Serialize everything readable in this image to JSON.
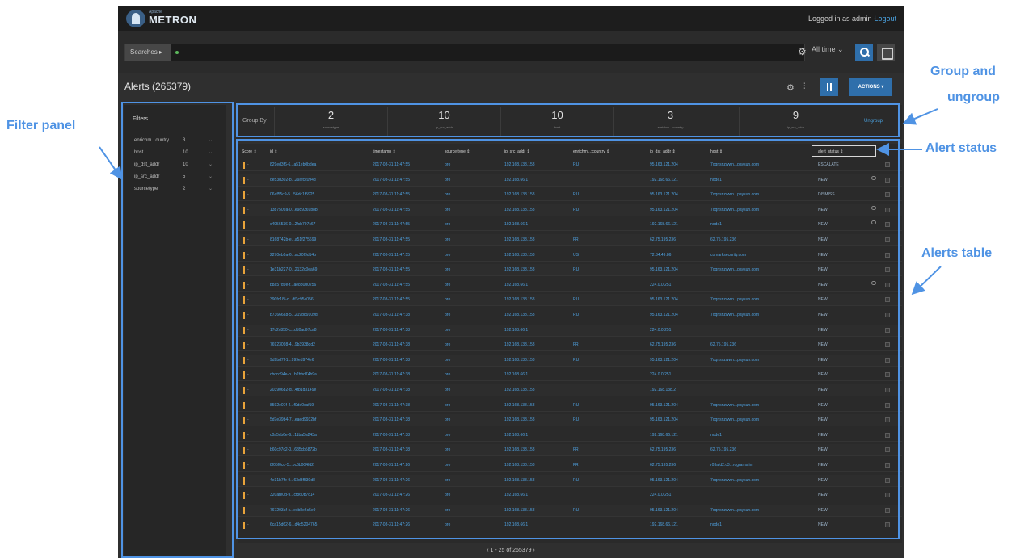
{
  "app": {
    "brand_small": "Apache",
    "brand": "METRON",
    "login_text": "Logged in as admin -",
    "logout_label": "Logout"
  },
  "search": {
    "searches_label": "Searches ▸",
    "time_range": "All time ⌄"
  },
  "alerts": {
    "title": "Alerts (265379)",
    "actions_label": "ACTIONS ▾"
  },
  "filters": {
    "title": "Filters",
    "items": [
      {
        "label": "enrichm...ountry",
        "count": "3"
      },
      {
        "label": "host",
        "count": "10"
      },
      {
        "label": "ip_dst_addr",
        "count": "10"
      },
      {
        "label": "ip_src_addr",
        "count": "5"
      },
      {
        "label": "sourcetype",
        "count": "2"
      }
    ]
  },
  "group_by": {
    "label": "Group By",
    "ungroup_label": "Ungroup",
    "groups": [
      {
        "count": "2",
        "label": "sourcetype"
      },
      {
        "count": "10",
        "label": "ip_src_addr"
      },
      {
        "count": "10",
        "label": "host"
      },
      {
        "count": "3",
        "label": "enrichm...:country"
      },
      {
        "count": "9",
        "label": "ip_src_addr"
      }
    ]
  },
  "table": {
    "columns": [
      "Score ⇕",
      "id ⇕",
      "timestamp ⇕",
      "source:type ⇕",
      "ip_src_addr ⇕",
      "enrichm...:country ⇕",
      "ip_dst_addr ⇕",
      "host ⇕",
      "alert_status ⇕"
    ],
    "rows": [
      [
        "829ed3f6-6...a51eb0bdea",
        "2017-08-31 11:47:55",
        "bro",
        "192.168.138.158",
        "RU",
        "95.163.121.204",
        "7oqnsnzwwn...paysun.com",
        "ESCALATE",
        false
      ],
      [
        "de53d302-b...29afcc094d",
        "2017-08-31 11:47:55",
        "bro",
        "192.168.66.1",
        "",
        "192.168.66.121",
        "node1",
        "NEW",
        true
      ],
      [
        "06af55c9-5...56dc1f5925",
        "2017-08-31 11:47:55",
        "bro",
        "192.168.138.158",
        "RU",
        "95.163.121.204",
        "7oqnsnzwwn...paysun.com",
        "DISMISS",
        false
      ],
      [
        "13b7509a-0...e989369b8b",
        "2017-08-31 11:47:55",
        "bro",
        "192.168.138.158",
        "RU",
        "95.163.121.204",
        "7oqnsnzwwn...paysun.com",
        "NEW",
        true
      ],
      [
        "c4956536-0...2fcb707c67",
        "2017-08-31 11:47:55",
        "bro",
        "192.168.66.1",
        "",
        "192.168.66.121",
        "node1",
        "NEW",
        true
      ],
      [
        "8168742b-e...a51f275699",
        "2017-08-31 11:47:55",
        "bro",
        "192.168.138.158",
        "FR",
        "62.75.195.236",
        "62.75.195.236",
        "NEW",
        false
      ],
      [
        "2270eb9a-6...ac20f9d14b",
        "2017-08-31 11:47:55",
        "bro",
        "192.168.138.158",
        "US",
        "72.34.49.86",
        "comarksecurity.com",
        "NEW",
        false
      ],
      [
        "1e31b227-0...2132c0ea69",
        "2017-08-31 11:47:55",
        "bro",
        "192.168.138.158",
        "RU",
        "95.163.121.204",
        "7oqnsnzwwn...paysun.com",
        "NEW",
        false
      ],
      [
        "b8a57d9e-f...ae8b0b0256",
        "2017-08-31 11:47:55",
        "bro",
        "192.168.66.1",
        "",
        "224.0.0.251",
        "",
        "NEW",
        true
      ],
      [
        "390fc18f-c...df3c95a056",
        "2017-08-31 11:47:55",
        "bro",
        "192.168.138.158",
        "RU",
        "95.163.121.204",
        "7oqnsnzwwn...paysun.com",
        "NEW",
        false
      ],
      [
        "b73666a8-5...219b89109d",
        "2017-08-31 11:47:38",
        "bro",
        "192.168.138.158",
        "RU",
        "95.163.121.204",
        "7oqnsnzwwn...paysun.com",
        "NEW",
        false
      ],
      [
        "17c2c850-c...dd0ad97ca8",
        "2017-08-31 11:47:38",
        "bro",
        "192.168.66.1",
        "",
        "224.0.0.251",
        "",
        "NEW",
        false
      ],
      [
        "76923098-4...9b3938dd2",
        "2017-08-31 11:47:38",
        "bro",
        "192.168.138.158",
        "FR",
        "62.75.195.236",
        "62.75.195.236",
        "NEW",
        false
      ],
      [
        "9d9bd7f-1...999ed974e6",
        "2017-08-31 11:47:38",
        "bro",
        "192.168.138.158",
        "RU",
        "95.163.121.204",
        "7oqnsnzwwn...paysun.com",
        "NEW",
        false
      ],
      [
        "cbccd94e-b...b2bbd74b9a",
        "2017-08-31 11:47:38",
        "bro",
        "192.168.66.1",
        "",
        "224.0.0.251",
        "",
        "NEW",
        false
      ],
      [
        "20390682-d...4fb1d3149e",
        "2017-08-31 11:47:38",
        "bro",
        "192.168.138.158",
        "",
        "192.168.138.2",
        "",
        "NEW",
        false
      ],
      [
        "8592e07f-4...f0de0caf19",
        "2017-08-31 11:47:38",
        "bro",
        "192.168.138.158",
        "RU",
        "95.163.121.204",
        "7oqnsnzwwn...paysun.com",
        "NEW",
        false
      ],
      [
        "5d7e39b4-7...eaed9932bf",
        "2017-08-31 11:47:38",
        "bro",
        "192.168.138.158",
        "RU",
        "95.163.121.204",
        "7oqnsnzwwn...paysun.com",
        "NEW",
        false
      ],
      [
        "c0a5cb6e-6...11ba5a243a",
        "2017-08-31 11:47:38",
        "bro",
        "192.168.66.1",
        "",
        "192.168.66.121",
        "node1",
        "NEW",
        false
      ],
      [
        "b60c97c2-0...635cb5872b",
        "2017-08-31 11:47:38",
        "bro",
        "192.168.138.158",
        "FR",
        "62.75.195.236",
        "62.75.195.236",
        "NEW",
        false
      ],
      [
        "8f05f0cd-5...bc6b004fd2",
        "2017-08-31 11:47:26",
        "bro",
        "192.168.138.158",
        "FR",
        "62.75.195.236",
        "r03afd2.c3...rograms.in",
        "NEW",
        false
      ],
      [
        "4e31b7fe-9...63d3f530d8",
        "2017-08-31 11:47:26",
        "bro",
        "192.168.138.158",
        "RU",
        "95.163.121.204",
        "7oqnsnzwwn...paysun.com",
        "NEW",
        false
      ],
      [
        "320afe0d-9...cf860b7c14",
        "2017-08-31 11:47:26",
        "bro",
        "192.168.66.1",
        "",
        "224.0.0.251",
        "",
        "NEW",
        false
      ],
      [
        "767203af-c...ecb8e6c5e9",
        "2017-08-31 11:47:26",
        "bro",
        "192.168.138.158",
        "RU",
        "95.163.121.204",
        "7oqnsnzwwn...paysun.com",
        "NEW",
        false
      ],
      [
        "6ca15d62-6...d4d5204765",
        "2017-08-31 11:47:26",
        "bro",
        "192.168.66.1",
        "",
        "192.168.66.121",
        "node1",
        "NEW",
        false
      ]
    ],
    "score": "-"
  },
  "pagination": "‹   1 - 25 of 265379   ›",
  "annotations": {
    "filter_panel": "Filter panel",
    "group_line1": "Group and",
    "group_line2": "ungroup",
    "alert_status": "Alert status",
    "alerts_table": "Alerts table",
    "color": "#4f93e4"
  }
}
